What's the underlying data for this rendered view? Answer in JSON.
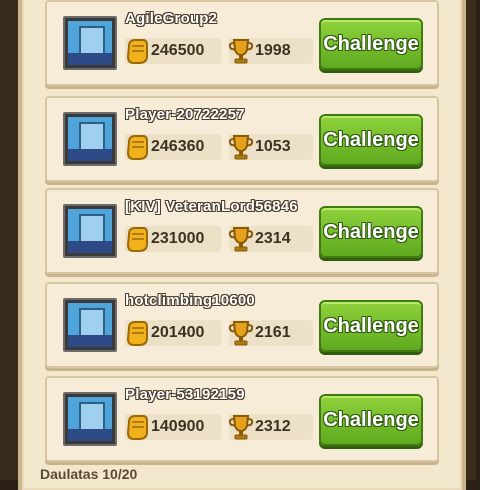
{
  "opponents": [
    {
      "name": "AgileGroup2",
      "gold": "246500",
      "trophies": "1998",
      "button": "Challenge"
    },
    {
      "name": "Player-20722257",
      "gold": "246360",
      "trophies": "1053",
      "button": "Challenge"
    },
    {
      "name": "[KIV] VeteranLord56846",
      "gold": "231000",
      "trophies": "2314",
      "button": "Challenge"
    },
    {
      "name": "hotclimbing10600",
      "gold": "201400",
      "trophies": "2161",
      "button": "Challenge"
    },
    {
      "name": "Player-53192159",
      "gold": "140900",
      "trophies": "2312",
      "button": "Challenge"
    }
  ],
  "footer": {
    "text": "Daulatas 10/20"
  },
  "colors": {
    "button_green": "#6fbf2a",
    "panel": "#f3e7cd",
    "row": "#f6ecd7"
  }
}
